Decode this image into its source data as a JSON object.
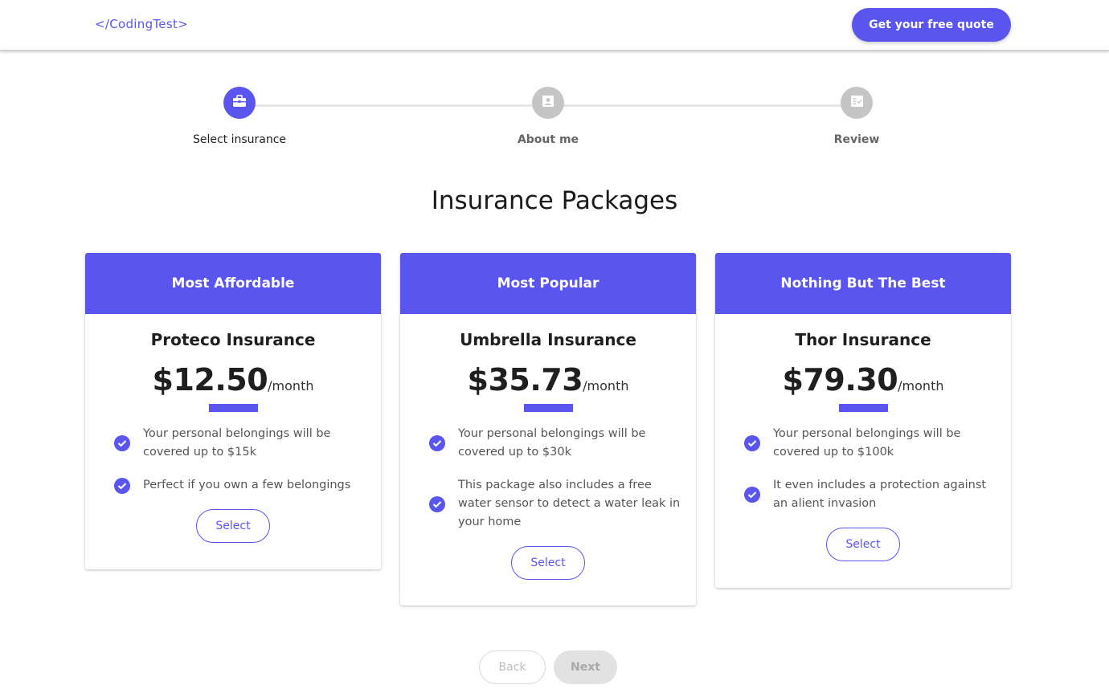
{
  "header": {
    "logo": "</CodingTest>",
    "cta_label": "Get your free quote"
  },
  "stepper": {
    "steps": [
      {
        "label": "Select insurance",
        "icon": "briefcase-icon",
        "state": "active"
      },
      {
        "label": "About me",
        "icon": "contact-card-icon",
        "state": "inactive"
      },
      {
        "label": "Review",
        "icon": "checklist-icon",
        "state": "inactive"
      }
    ]
  },
  "main": {
    "title": "Insurance Packages",
    "packages": [
      {
        "tier": "Most Affordable",
        "name": "Proteco Insurance",
        "price": "$12.50",
        "period": "/month",
        "features": [
          "Your personal belongings will be covered up to $15k",
          "Perfect if you own a few belongings"
        ],
        "select_label": "Select"
      },
      {
        "tier": "Most Popular",
        "name": "Umbrella Insurance",
        "price": "$35.73",
        "period": "/month",
        "features": [
          "Your personal belongings will be covered up to $30k",
          "This package also includes a free water sensor to detect a water leak in your home"
        ],
        "select_label": "Select"
      },
      {
        "tier": "Nothing But The Best",
        "name": "Thor Insurance",
        "price": "$79.30",
        "period": "/month",
        "features": [
          "Your personal belongings will be covered up to $100k",
          "It even includes a protection against an alient invasion"
        ],
        "select_label": "Select"
      }
    ]
  },
  "footer": {
    "back_label": "Back",
    "next_label": "Next"
  },
  "colors": {
    "accent": "#5a55ef",
    "inactive": "#c5c5c5"
  }
}
